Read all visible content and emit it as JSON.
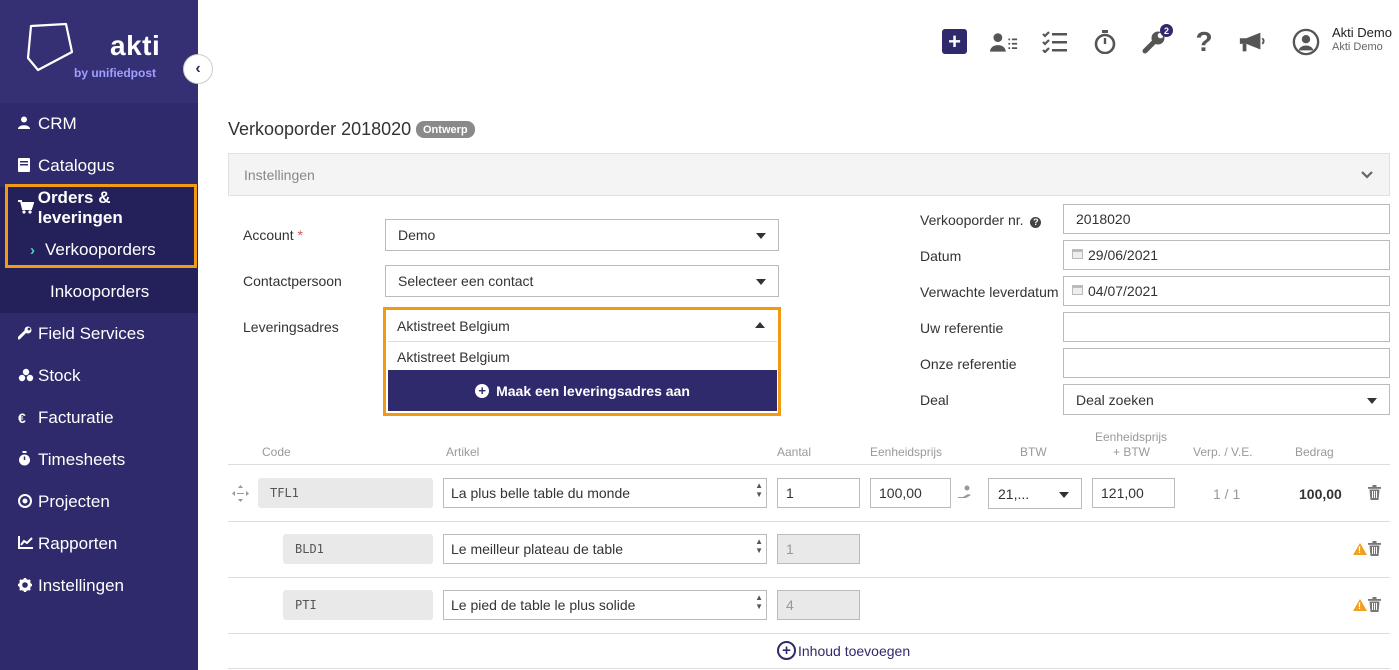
{
  "brand": {
    "name": "akti",
    "sub": "by unifiedpost"
  },
  "sidebar": {
    "items": [
      {
        "label": "CRM",
        "icon": "user-icon"
      },
      {
        "label": "Catalogus",
        "icon": "book-icon"
      },
      {
        "label": "Orders & leveringen",
        "icon": "cart-icon"
      },
      {
        "label": "Verkooporders",
        "icon": "chevron-right-icon"
      },
      {
        "label": "Inkooporders",
        "icon": ""
      },
      {
        "label": "Field Services",
        "icon": "wrench-icon"
      },
      {
        "label": "Stock",
        "icon": "boxes-icon"
      },
      {
        "label": "Facturatie",
        "icon": "euro-icon"
      },
      {
        "label": "Timesheets",
        "icon": "stopwatch-icon"
      },
      {
        "label": "Projecten",
        "icon": "target-icon"
      },
      {
        "label": "Rapporten",
        "icon": "chart-icon"
      },
      {
        "label": "Instellingen",
        "icon": "gear-icon"
      }
    ]
  },
  "topbar": {
    "badge_count": "2",
    "user_name": "Akti Demo",
    "user_company": "Akti Demo"
  },
  "page": {
    "title": "Verkooporder 2018020",
    "status": "Ontwerp",
    "settings_label": "Instellingen"
  },
  "form_left": {
    "account_label": "Account",
    "account_required": "*",
    "account_value": "Demo",
    "contact_label": "Contactpersoon",
    "contact_value": "Selecteer een contact",
    "address_label": "Leveringsadres",
    "address_value": "Aktistreet Belgium",
    "dropdown_option": "Aktistreet Belgium",
    "dropdown_create": "Maak een leveringsadres aan"
  },
  "form_right": {
    "order_nr_label": "Verkooporder nr.",
    "order_nr_value": "2018020",
    "date_label": "Datum",
    "date_value": "29/06/2021",
    "delivery_label": "Verwachte leverdatum",
    "delivery_value": "04/07/2021",
    "your_ref_label": "Uw referentie",
    "your_ref_value": "",
    "our_ref_label": "Onze referentie",
    "our_ref_value": "",
    "deal_label": "Deal",
    "deal_value": "Deal zoeken"
  },
  "table": {
    "headers": {
      "code": "Code",
      "article": "Artikel",
      "qty": "Aantal",
      "unit_price": "Eenheidsprijs",
      "vat": "BTW",
      "unit_price_vat_1": "Eenheidsprijs",
      "unit_price_vat_2": "+ BTW",
      "pack": "Verp. / V.E.",
      "amount": "Bedrag"
    },
    "rows": [
      {
        "code": "TFL1",
        "article": "La plus belle table du monde",
        "qty": "1",
        "unit_price": "100,00",
        "vat": "21,...",
        "unit_price_vat": "121,00",
        "pack": "1 / 1",
        "amount": "100,00"
      },
      {
        "code": "BLD1",
        "article": "Le meilleur plateau de table",
        "qty": "1"
      },
      {
        "code": "PTI",
        "article": "Le pied de table le plus solide",
        "qty": "4"
      }
    ],
    "add_content": "Inhoud toevoegen"
  }
}
